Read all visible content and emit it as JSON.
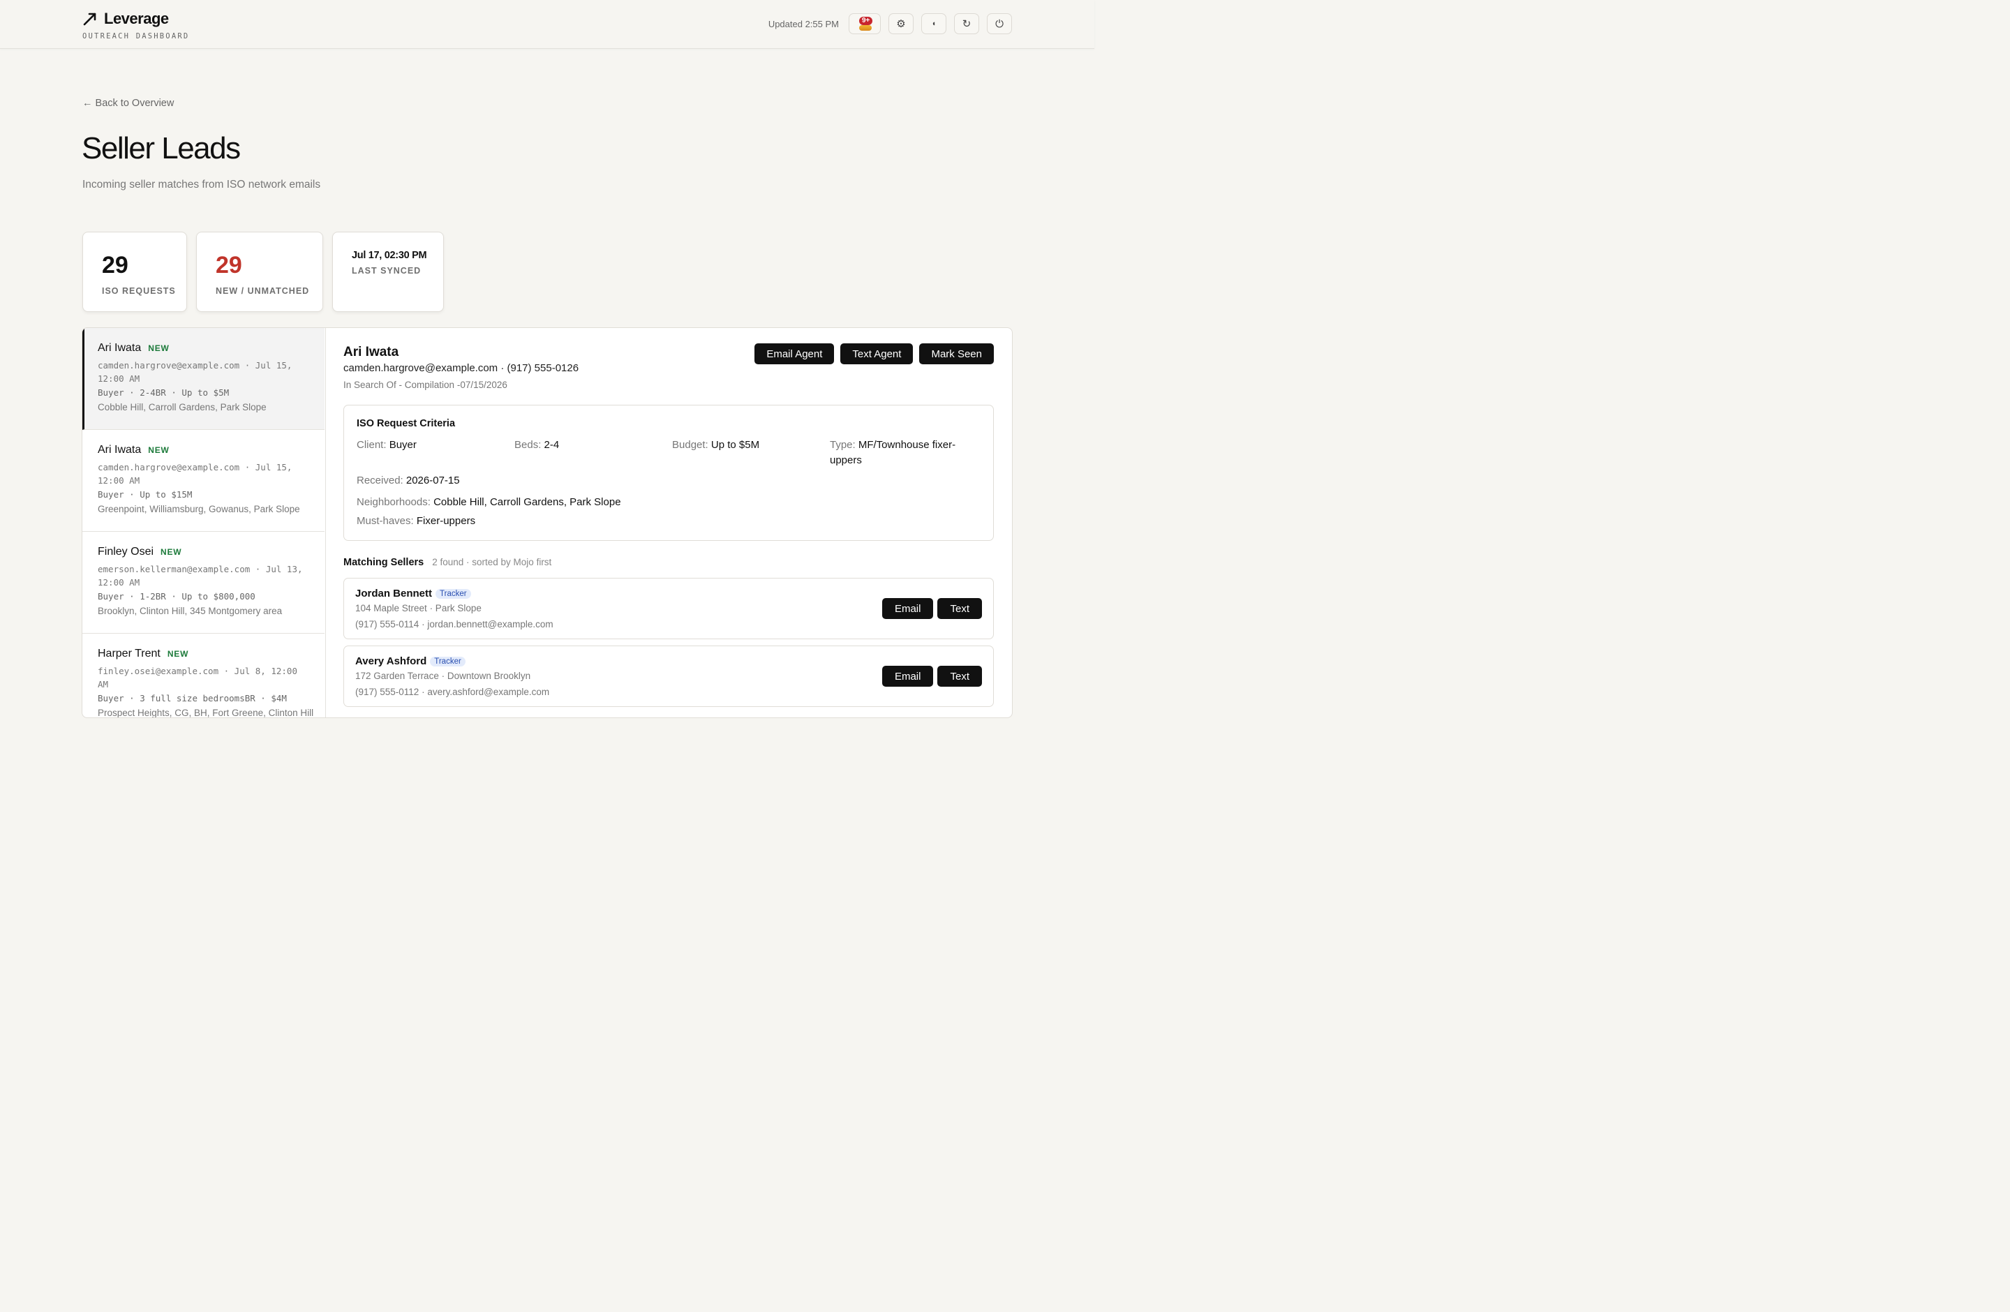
{
  "header": {
    "brand": "Leverage",
    "subtitle": "OUTREACH DASHBOARD",
    "updated": "Updated 2:55 PM",
    "notif_count": "9+"
  },
  "page": {
    "back_link": "← Back to Overview",
    "title": "Seller Leads",
    "subtitle": "Incoming seller matches from ISO network emails"
  },
  "stats": [
    {
      "value": "29",
      "label": "ISO REQUESTS"
    },
    {
      "value": "29",
      "label": "NEW / UNMATCHED",
      "color": "#c0342a"
    },
    {
      "value": "Jul 17, 02:30 PM",
      "label": "LAST SYNCED"
    }
  ],
  "leads": [
    {
      "name": "Ari Iwata",
      "badge": "NEW",
      "meta": "camden.hargrove@example.com · Jul 15, 12:00 AM",
      "criteria": "Buyer · 2-4BR · Up to $5M",
      "hoods": "Cobble Hill, Carroll Gardens, Park Slope"
    },
    {
      "name": "Ari Iwata",
      "badge": "NEW",
      "meta": "camden.hargrove@example.com · Jul 15, 12:00 AM",
      "criteria": "Buyer · Up to $15M",
      "hoods": "Greenpoint, Williamsburg, Gowanus, Park Slope"
    },
    {
      "name": "Finley Osei",
      "badge": "NEW",
      "meta": "emerson.kellerman@example.com · Jul 13, 12:00 AM",
      "criteria": "Buyer · 1-2BR · Up to $800,000",
      "hoods": "Brooklyn, Clinton Hill, 345 Montgomery area"
    },
    {
      "name": "Harper Trent",
      "badge": "NEW",
      "meta": "finley.osei@example.com · Jul 8, 12:00 AM",
      "criteria": "Buyer · 3 full size bedroomsBR · $4M",
      "hoods": "Prospect Heights, CG, BH, Fort Greene, Clinton Hill"
    }
  ],
  "detail": {
    "name": "Ari Iwata",
    "contact": "camden.hargrove@example.com · (917) 555-0126",
    "source": "In Search Of - Compilation -07/15/2026",
    "actions": {
      "email": "Email Agent",
      "text": "Text Agent",
      "seen": "Mark Seen"
    },
    "criteria": {
      "title": "ISO Request Criteria",
      "client_label": "Client:",
      "client": "Buyer",
      "beds_label": "Beds:",
      "beds": "2-4",
      "budget_label": "Budget:",
      "budget": "Up to $5M",
      "type_label": "Type:",
      "type": "MF/Townhouse fixer-uppers",
      "received_label": "Received:",
      "received": "2026-07-15",
      "hoods_label": "Neighborhoods:",
      "hoods": "Cobble Hill, Carroll Gardens, Park Slope",
      "musthaves_label": "Must-haves:",
      "musthaves": "Fixer-uppers"
    },
    "matching": {
      "title": "Matching Sellers",
      "subtitle": "2 found · sorted by Mojo first",
      "sellers": [
        {
          "name": "Jordan Bennett",
          "tag": "Tracker",
          "address": "104 Maple Street · Park Slope",
          "contact": "(917) 555-0114 · jordan.bennett@example.com",
          "email_btn": "Email",
          "text_btn": "Text"
        },
        {
          "name": "Avery Ashford",
          "tag": "Tracker",
          "address": "172 Garden Terrace · Downtown Brooklyn",
          "contact": "(917) 555-0112 · avery.ashford@example.com",
          "email_btn": "Email",
          "text_btn": "Text"
        }
      ]
    }
  }
}
